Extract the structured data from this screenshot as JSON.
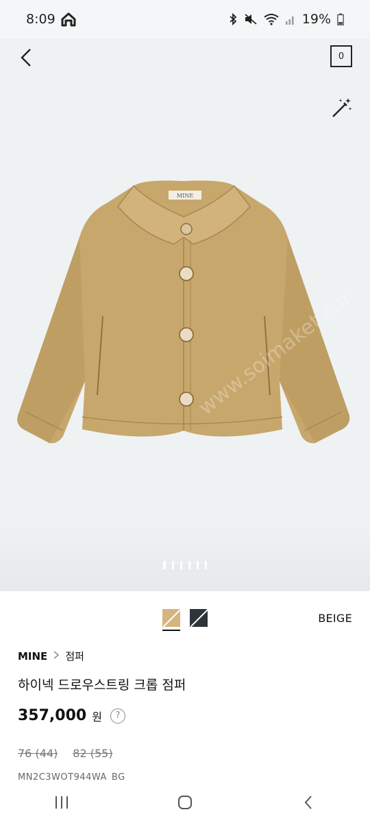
{
  "status_bar": {
    "time": "8:09",
    "battery": "19%"
  },
  "header": {
    "cart_count": "0"
  },
  "gallery": {
    "image_label": "MINE",
    "watermark": "www.soimaket.com/soimaket",
    "page_count": 6,
    "active_page": 1
  },
  "colors": {
    "options": [
      {
        "name": "BEIGE",
        "hex": "#d4b580"
      },
      {
        "name": "NAVY",
        "hex": "#2e3438"
      }
    ],
    "selected": "BEIGE"
  },
  "product": {
    "brand": "MINE",
    "category": "점퍼",
    "title": "하이넥 드로우스트링 크롭 점퍼",
    "price": "357,000",
    "currency": "원",
    "sizes": [
      "76 (44)",
      "82 (55)"
    ],
    "sku": "MN2C3WOT944WA_BG"
  },
  "icons": {
    "back": "chevron-left-icon",
    "magic": "magic-wand-icon",
    "help": "question-circle-icon"
  }
}
